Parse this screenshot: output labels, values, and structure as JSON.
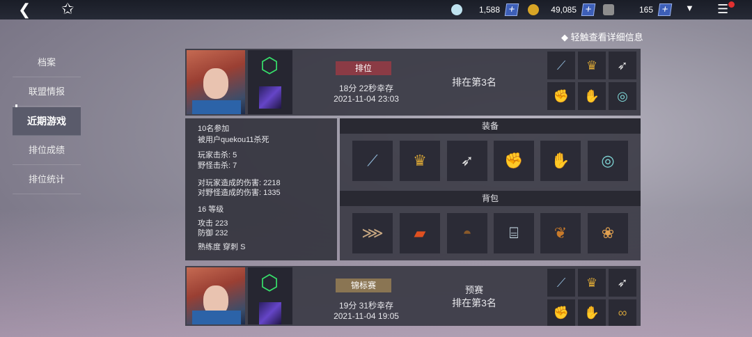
{
  "topbar": {
    "currencies": [
      {
        "icon": "crystal-icon",
        "value": "1,588",
        "color": "#bfe3f0"
      },
      {
        "icon": "gold-coin-icon",
        "value": "49,085",
        "color": "#d8a526"
      },
      {
        "icon": "ticket-icon",
        "value": "165",
        "color": "#cccccc"
      }
    ],
    "hint": "◆ 轻触查看详细信息"
  },
  "sidebar": {
    "items": [
      {
        "label": "档案"
      },
      {
        "label": "联盟情报"
      },
      {
        "label": "近期游戏"
      },
      {
        "label": "排位成绩"
      },
      {
        "label": "排位统计"
      }
    ]
  },
  "match1": {
    "tag": "排位",
    "survive": "18分 22秒幸存",
    "date": "2021-11-04 23:03",
    "place": "排在第3名"
  },
  "match2": {
    "tag": "锦标赛",
    "survive": "19分 31秒幸存",
    "date": "2021-11-04 19:05",
    "stage": "预赛",
    "place": "排在第3名"
  },
  "detail": {
    "participants": "10名参加",
    "killed_by": "被用户quekou11杀死",
    "player_kills": "玩家击杀: 5",
    "monster_kills": "野怪击杀: 7",
    "player_damage": "对玩家造成的伤害: 2218",
    "monster_damage": "对野怪造成的伤害: 1335",
    "level": "16 等级",
    "attack": "攻击 223",
    "defense": "防御 232",
    "mastery": "熟练度  穿刺 S"
  },
  "equipment": {
    "title": "装备",
    "items": [
      "rifle-icon",
      "crown-icon",
      "feather-icon",
      "glove-icon",
      "gauntlet-icon",
      "bracelet-icon"
    ]
  },
  "bag": {
    "title": "背包",
    "items": [
      "fish-icon",
      "bread-brick-icon",
      "curry-dish-icon",
      "water-bottle-icon",
      "fried-food-icon",
      "fried-chicken-icon"
    ]
  },
  "colors": {
    "clan_hex": "#37e06b",
    "rank_tag": "#8b3b45",
    "tourn_tag": "#8a7553",
    "plus_button": "#3d5fb8"
  }
}
